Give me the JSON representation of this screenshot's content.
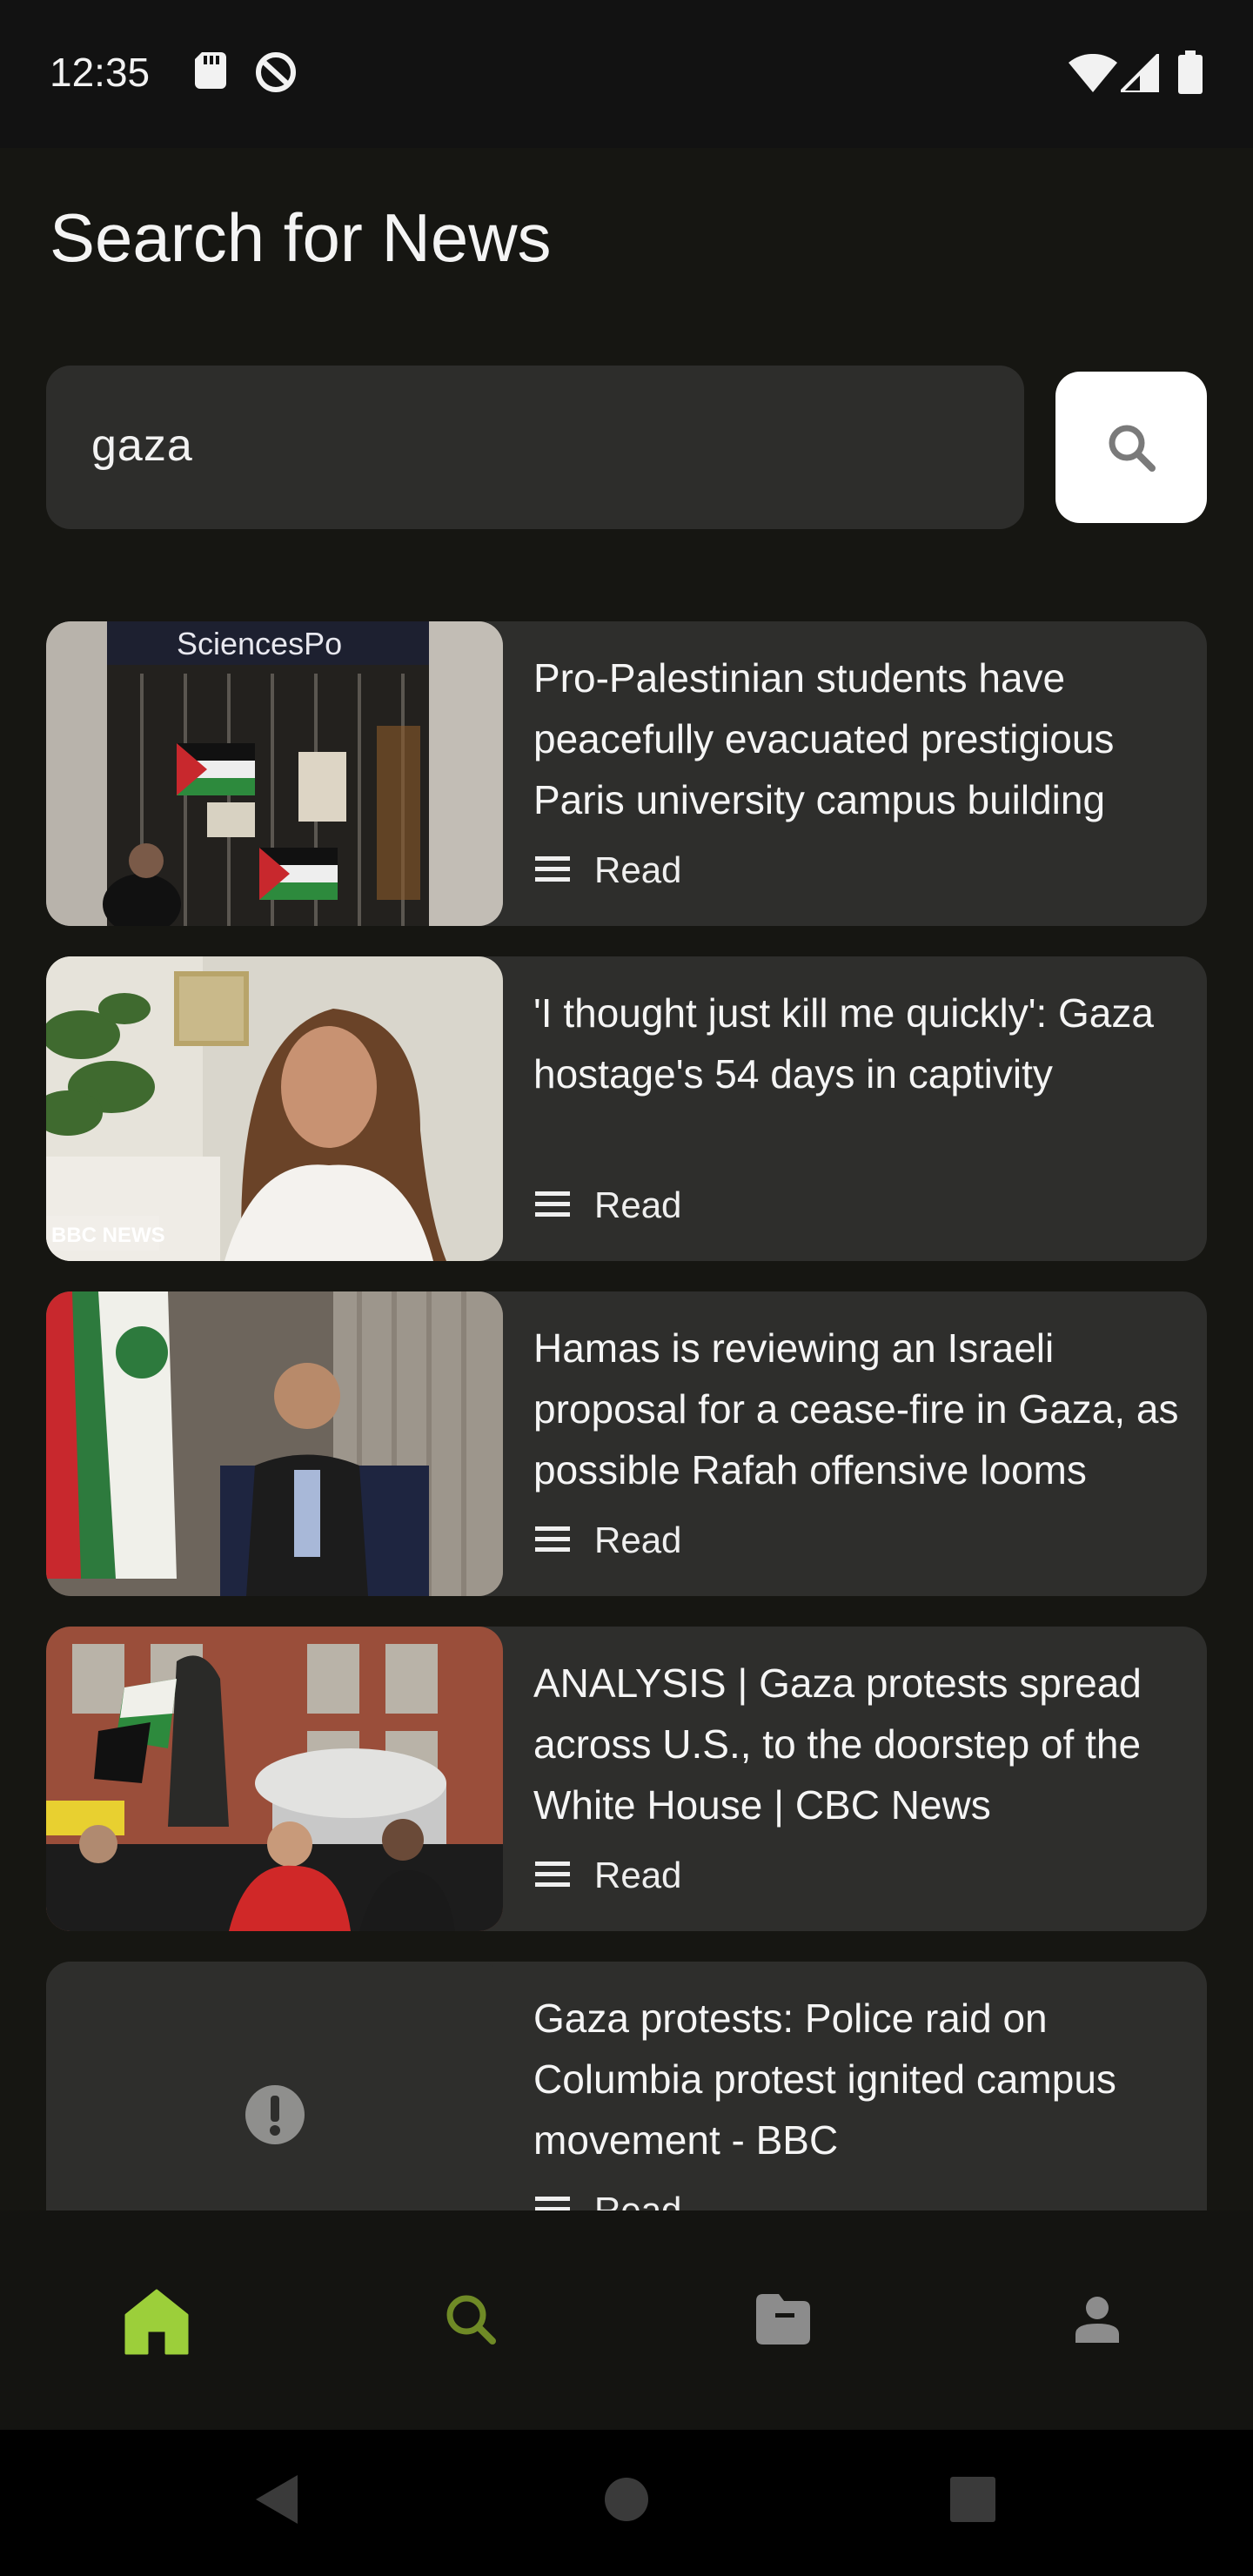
{
  "status_bar": {
    "time": "12:35",
    "left_icons": [
      "sd-card-icon",
      "data-saver-icon"
    ],
    "right_icons": [
      "wifi-icon",
      "signal-icon",
      "battery-icon"
    ]
  },
  "page": {
    "title": "Search for News"
  },
  "search": {
    "value": "gaza",
    "button_icon": "search-icon"
  },
  "articles": [
    {
      "title": "Pro-Palestinian students have peacefully evacuated prestigious Paris university campus building",
      "read_label": "Read",
      "thumbnail": "protest-gate-photo",
      "thumbnail_text": "SciencesPo"
    },
    {
      "title": "'I thought just kill me quickly': Gaza hostage's 54 days in captivity",
      "read_label": "Read",
      "thumbnail": "woman-portrait-photo",
      "thumbnail_text": "BBC NEWS"
    },
    {
      "title": "Hamas is reviewing an Israeli proposal for a cease-fire in Gaza, as possible Rafah offensive looms",
      "read_label": "Read",
      "thumbnail": "man-seated-flags-photo"
    },
    {
      "title": "ANALYSIS | Gaza protests spread across U.S., to the doorstep of the White House | CBC News",
      "read_label": "Read",
      "thumbnail": "street-protest-photo"
    },
    {
      "title": "Gaza protests: Police raid on Columbia protest ignited campus movement - BBC",
      "read_label": "Read",
      "thumbnail": "image-error-icon"
    }
  ],
  "bottom_nav": {
    "items": [
      {
        "name": "home",
        "icon": "home-icon",
        "active": true
      },
      {
        "name": "search",
        "icon": "search-icon",
        "active": false
      },
      {
        "name": "saved",
        "icon": "folder-icon",
        "active": false
      },
      {
        "name": "profile",
        "icon": "person-icon",
        "active": false
      }
    ]
  },
  "colors": {
    "accent": "#9ccf3a",
    "accent_dim": "#6f8a26",
    "background": "#161612",
    "card": "#2e2e2c",
    "inactive_icon": "#8c8c8c"
  }
}
